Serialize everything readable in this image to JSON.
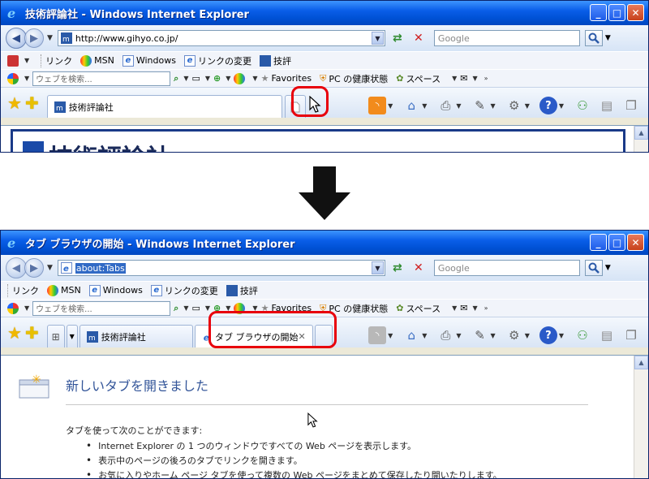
{
  "window1": {
    "title": "技術評論社 - Windows Internet Explorer",
    "address": "http://www.gihyo.co.jp/",
    "search_placeholder": "Google",
    "links": [
      "リンク",
      "MSN",
      "Windows",
      "リンクの変更",
      "技評"
    ],
    "toolbar2": {
      "search_placeholder": "ウェブを検索...",
      "favorites": "Favorites",
      "pc_health": "PC の健康状態",
      "space": "スペース"
    },
    "tab_label": "技術評論社",
    "page_heading_fragment": "技術評論社"
  },
  "window2": {
    "title": "タブ ブラウザの開始 - Windows Internet Explorer",
    "address": "about:Tabs",
    "search_placeholder": "Google",
    "links": [
      "リンク",
      "MSN",
      "Windows",
      "リンクの変更",
      "技評"
    ],
    "toolbar2": {
      "search_placeholder": "ウェブを検索...",
      "favorites": "Favorites",
      "pc_health": "PC の健康状態",
      "space": "スペース"
    },
    "tabs": [
      "技術評論社",
      "タブ ブラウザの開始"
    ],
    "content": {
      "title": "新しいタブを開きました",
      "intro": "タブを使って次のことができます:",
      "bullets": [
        "Internet Explorer の 1 つのウィンドウですべての Web ページを表示します。",
        "表示中のページの後ろのタブでリンクを開きます。",
        "お気に入りやホーム ページ タブを使って複数の Web ページをまとめて保存したり開いたりします。"
      ]
    }
  },
  "colors": {
    "titlebar": "#0052d6",
    "highlight": "#e8000b",
    "accent_blue": "#335599"
  }
}
